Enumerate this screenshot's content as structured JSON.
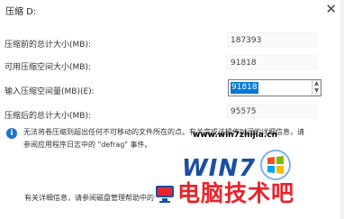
{
  "dialog": {
    "title": "压缩 D:",
    "close_icon": "close-icon"
  },
  "rows": [
    {
      "label": "压缩前的总计大小(MB):",
      "value": "187393"
    },
    {
      "label": "可用压缩空间大小(MB):",
      "value": "91818"
    },
    {
      "label": "输入压缩空间量(MB)(E):",
      "value": "91818"
    },
    {
      "label": "压缩后的总计大小(MB):",
      "value": "95575"
    }
  ],
  "info": {
    "icon": "info-icon",
    "line1": "无法将卷压缩到超出任何不可移动的文件所在的点。有关完成该操作时间的详细信息，请",
    "line2": "参阅应用程序日志中的 \"defrag\" 事件。"
  },
  "help_text": "有关详细信息，请参阅磁盘管理帮助中的",
  "watermark": {
    "url": "www.win7zhijia.cn",
    "brand": "WIN7",
    "big_text": "电脑技术吧"
  },
  "colors": {
    "selection": "#0078d7",
    "watermark_red": "#e8242c",
    "watermark_blue": "#1b4fa3",
    "info_blue": "#1e73c9"
  }
}
